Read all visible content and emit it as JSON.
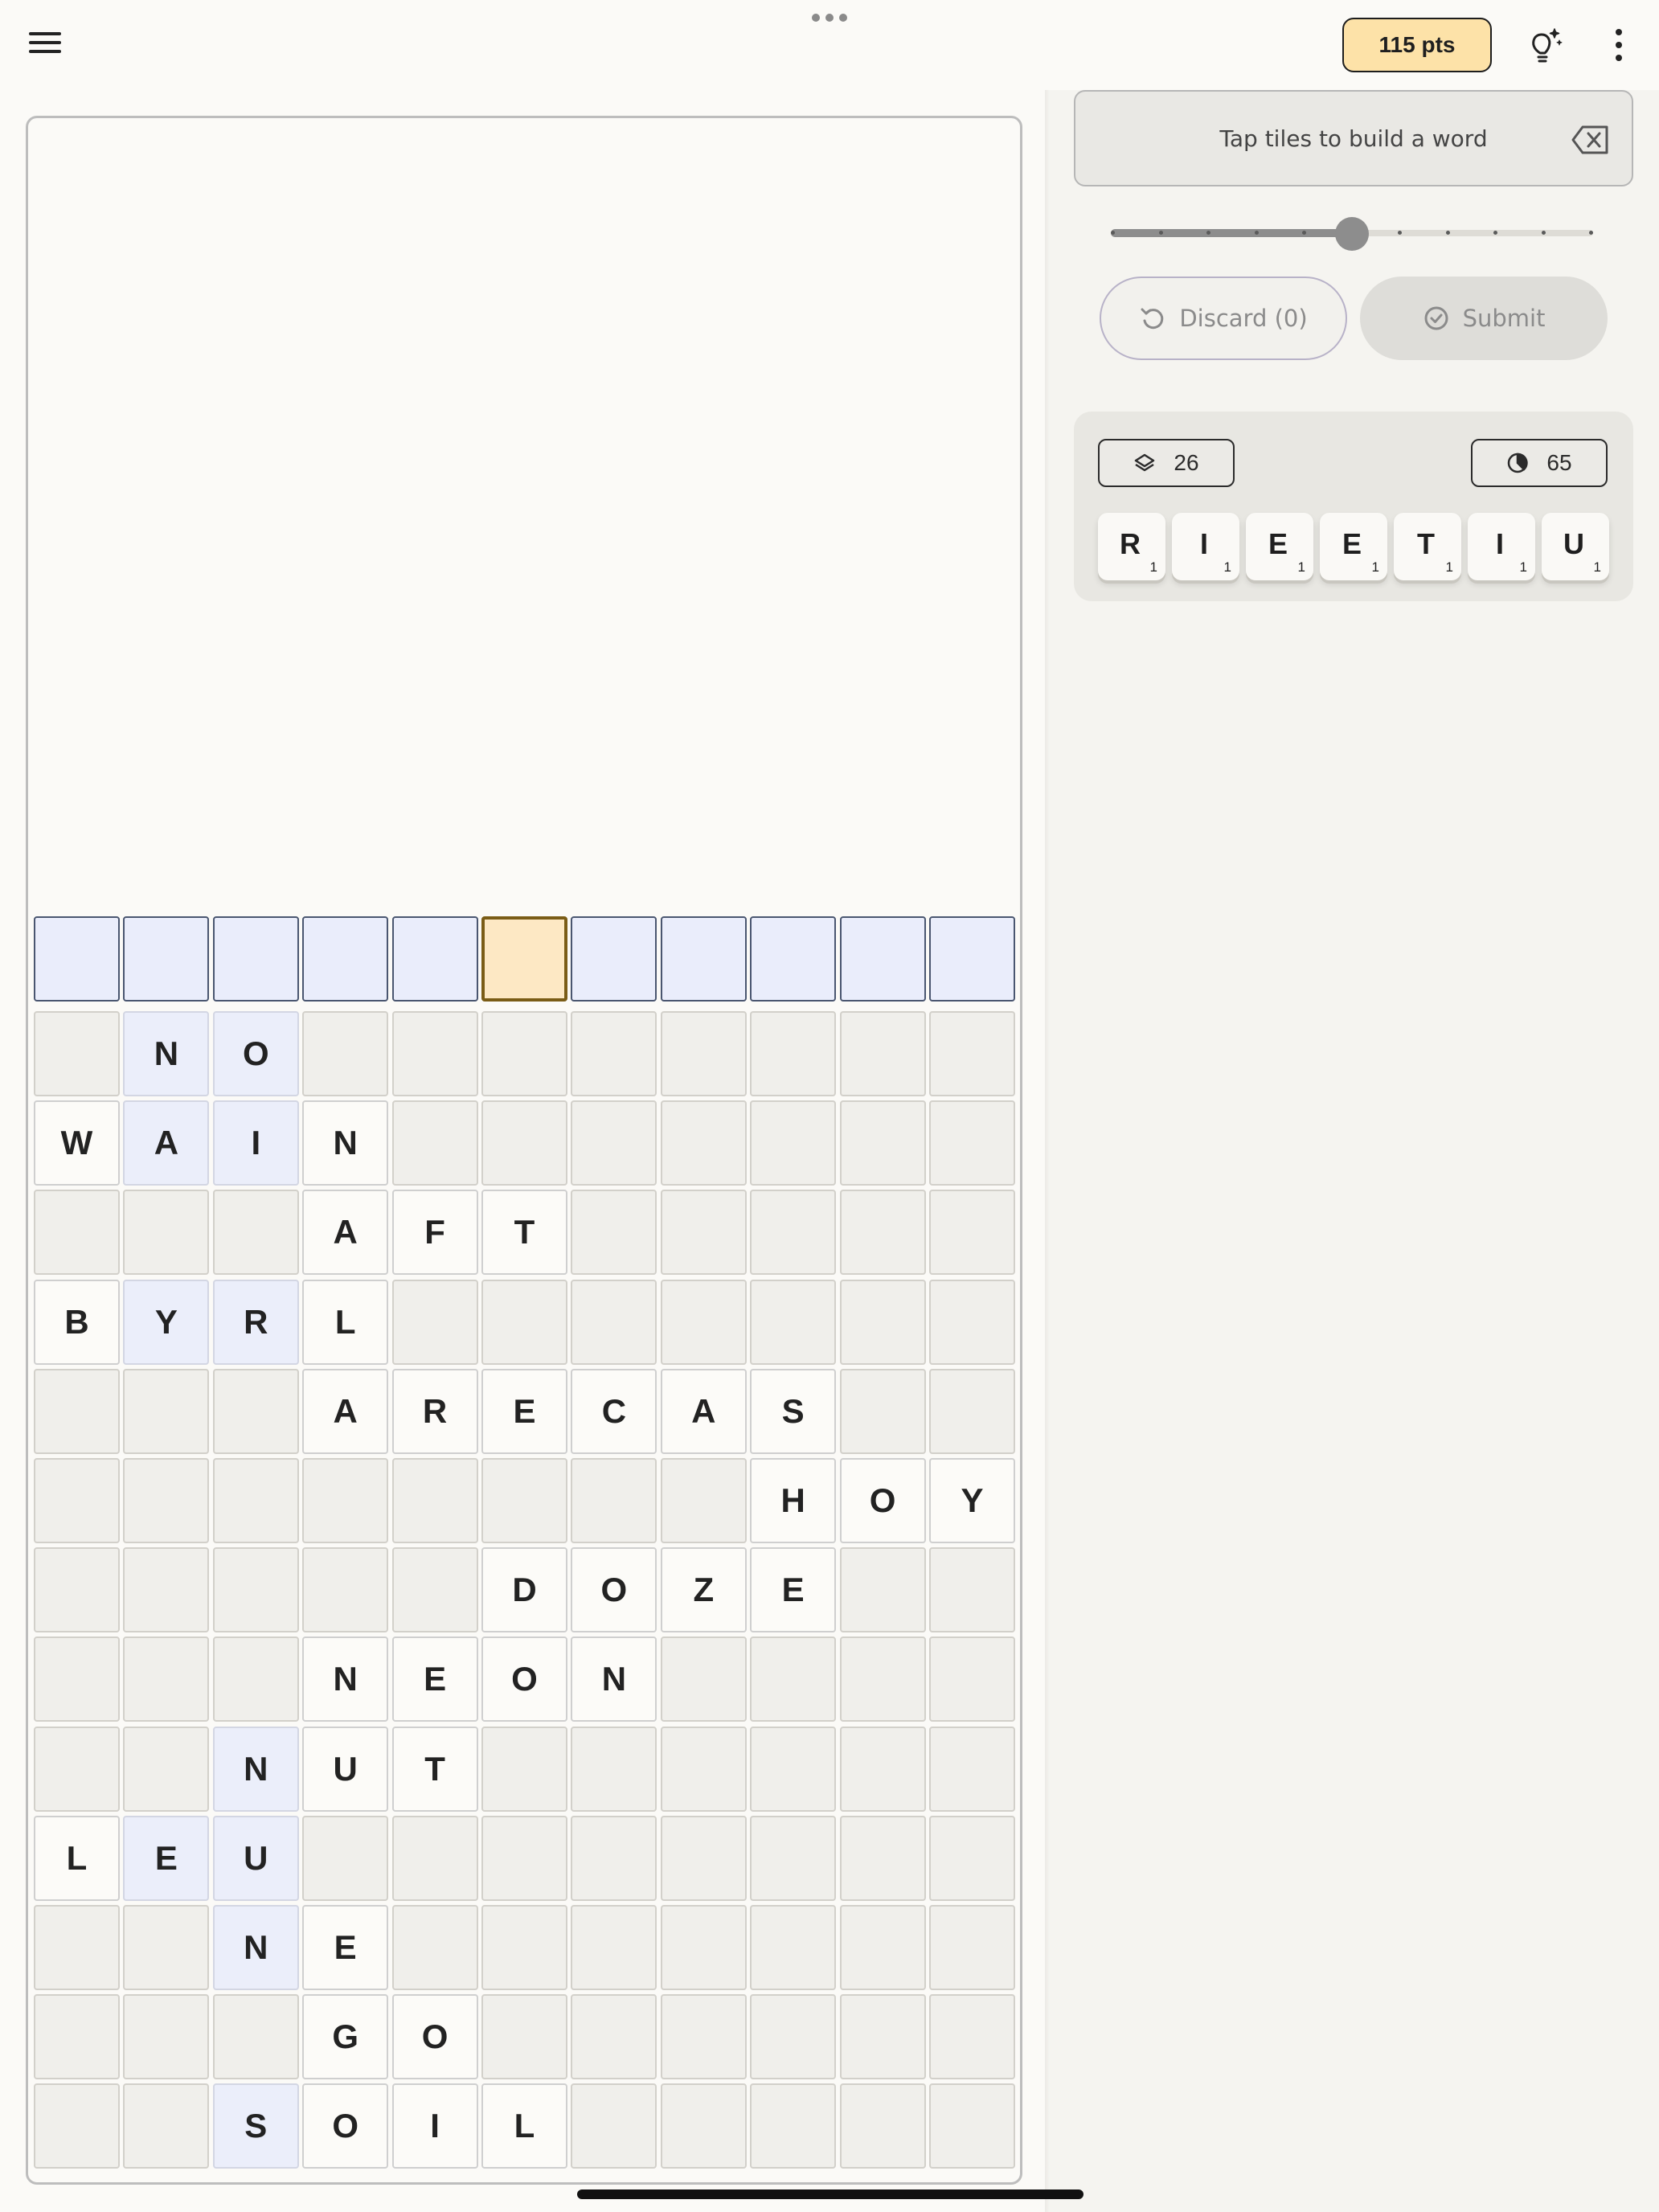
{
  "header": {
    "score_label": "115 pts",
    "menu_icon": "hamburger-menu-icon",
    "hint_icon": "lightbulb-sparkle-icon",
    "more_icon": "more-vertical-icon"
  },
  "word_builder": {
    "placeholder": "Tap tiles to build a word",
    "clear_icon": "backspace-icon"
  },
  "slider": {
    "steps": 11,
    "value_step": 5
  },
  "actions": {
    "discard_label": "Discard (0)",
    "submit_label": "Submit"
  },
  "rack_panel": {
    "tiles_remaining": "26",
    "timer_value": "65",
    "tiles_icon": "layers-icon",
    "timer_icon": "timer-icon",
    "tiles": [
      {
        "letter": "R",
        "value": "1"
      },
      {
        "letter": "I",
        "value": "1"
      },
      {
        "letter": "E",
        "value": "1"
      },
      {
        "letter": "E",
        "value": "1"
      },
      {
        "letter": "T",
        "value": "1"
      },
      {
        "letter": "I",
        "value": "1"
      },
      {
        "letter": "U",
        "value": "1"
      }
    ]
  },
  "board": {
    "columns": 11,
    "active_slot": 5,
    "rows": [
      [
        " ",
        "N",
        "O",
        " ",
        " ",
        " ",
        " ",
        " ",
        " ",
        " ",
        " "
      ],
      [
        "W",
        "A",
        "I",
        "N",
        " ",
        " ",
        " ",
        " ",
        " ",
        " ",
        " "
      ],
      [
        " ",
        " ",
        " ",
        "A",
        "F",
        "T",
        " ",
        " ",
        " ",
        " ",
        " "
      ],
      [
        "B",
        "Y",
        "R",
        "L",
        " ",
        " ",
        " ",
        " ",
        " ",
        " ",
        " "
      ],
      [
        " ",
        " ",
        " ",
        "A",
        "R",
        "E",
        "C",
        "A",
        "S",
        " ",
        " "
      ],
      [
        " ",
        " ",
        " ",
        " ",
        " ",
        " ",
        " ",
        " ",
        "H",
        "O",
        "Y"
      ],
      [
        " ",
        " ",
        " ",
        " ",
        " ",
        "D",
        "O",
        "Z",
        "E",
        " ",
        " "
      ],
      [
        " ",
        " ",
        " ",
        "N",
        "E",
        "O",
        "N",
        " ",
        " ",
        " ",
        " "
      ],
      [
        " ",
        " ",
        "N",
        "U",
        "T",
        " ",
        " ",
        " ",
        " ",
        " ",
        " "
      ],
      [
        "L",
        "E",
        "U",
        " ",
        " ",
        " ",
        " ",
        " ",
        " ",
        " ",
        " "
      ],
      [
        " ",
        " ",
        "N",
        "E",
        " ",
        " ",
        " ",
        " ",
        " ",
        " ",
        " "
      ],
      [
        " ",
        " ",
        " ",
        "G",
        "O",
        " ",
        " ",
        " ",
        " ",
        " ",
        " "
      ],
      [
        " ",
        " ",
        "S",
        "O",
        "I",
        "L",
        " ",
        " ",
        " ",
        " ",
        " "
      ]
    ],
    "highlighted": [
      [
        0,
        1
      ],
      [
        0,
        2
      ],
      [
        1,
        1
      ],
      [
        1,
        2
      ],
      [
        3,
        1
      ],
      [
        3,
        2
      ],
      [
        8,
        2
      ],
      [
        9,
        1
      ],
      [
        9,
        2
      ],
      [
        10,
        2
      ],
      [
        12,
        2
      ]
    ]
  }
}
